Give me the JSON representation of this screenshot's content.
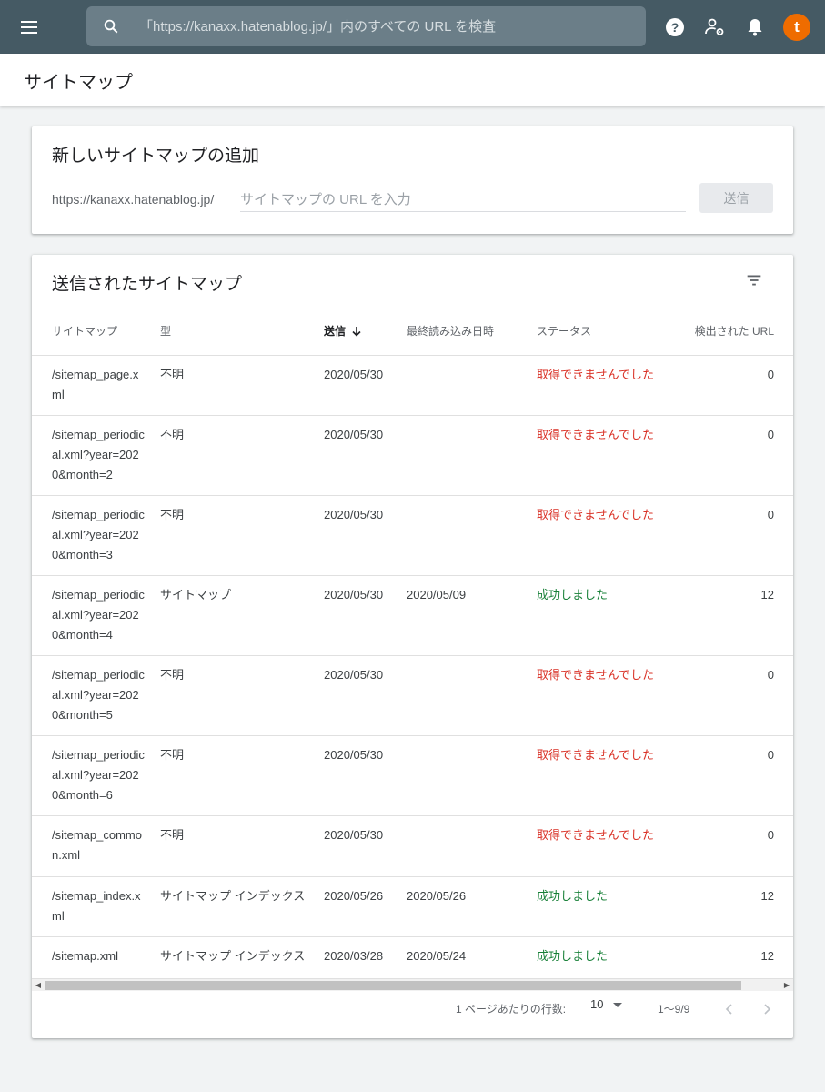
{
  "header": {
    "search_placeholder": "「https://kanaxx.hatenablog.jp/」内のすべての URL を検査",
    "avatar_letter": "t",
    "avatar_color": "#ef6c00"
  },
  "page": {
    "title": "サイトマップ"
  },
  "add_card": {
    "title": "新しいサイトマップの追加",
    "prefix": "https://kanaxx.hatenablog.jp/",
    "input_placeholder": "サイトマップの URL を入力",
    "submit_label": "送信"
  },
  "list_card": {
    "title": "送信されたサイトマップ",
    "columns": [
      "サイトマップ",
      "型",
      "送信",
      "最終読み込み日時",
      "ステータス",
      "検出された URL"
    ],
    "sort_column": "送信",
    "sort_direction": "desc",
    "rows": [
      {
        "path": "/sitemap_page.xml",
        "type": "不明",
        "submitted": "2020/05/30",
        "last_read": "",
        "status": "取得できませんでした",
        "status_ok": false,
        "count": "0"
      },
      {
        "path": "/sitemap_periodical.xml?year=2020&month=2",
        "type": "不明",
        "submitted": "2020/05/30",
        "last_read": "",
        "status": "取得できませんでした",
        "status_ok": false,
        "count": "0"
      },
      {
        "path": "/sitemap_periodical.xml?year=2020&month=3",
        "type": "不明",
        "submitted": "2020/05/30",
        "last_read": "",
        "status": "取得できませんでした",
        "status_ok": false,
        "count": "0"
      },
      {
        "path": "/sitemap_periodical.xml?year=2020&month=4",
        "type": "サイトマップ",
        "submitted": "2020/05/30",
        "last_read": "2020/05/09",
        "status": "成功しました",
        "status_ok": true,
        "count": "12"
      },
      {
        "path": "/sitemap_periodical.xml?year=2020&month=5",
        "type": "不明",
        "submitted": "2020/05/30",
        "last_read": "",
        "status": "取得できませんでした",
        "status_ok": false,
        "count": "0"
      },
      {
        "path": "/sitemap_periodical.xml?year=2020&month=6",
        "type": "不明",
        "submitted": "2020/05/30",
        "last_read": "",
        "status": "取得できませんでした",
        "status_ok": false,
        "count": "0"
      },
      {
        "path": "/sitemap_common.xml",
        "type": "不明",
        "submitted": "2020/05/30",
        "last_read": "",
        "status": "取得できませんでした",
        "status_ok": false,
        "count": "0"
      },
      {
        "path": "/sitemap_index.xml",
        "type": "サイトマップ インデックス",
        "submitted": "2020/05/26",
        "last_read": "2020/05/26",
        "status": "成功しました",
        "status_ok": true,
        "count": "12"
      },
      {
        "path": "/sitemap.xml",
        "type": "サイトマップ インデックス",
        "submitted": "2020/03/28",
        "last_read": "2020/05/24",
        "status": "成功しました",
        "status_ok": true,
        "count": "12"
      }
    ],
    "pagination": {
      "rows_per_page_label": "1 ページあたりの行数:",
      "rows_per_page": "10",
      "range": "1〜9/9"
    }
  },
  "colors": {
    "topbar": "#455a64",
    "fail": "#d93025",
    "success": "#188038"
  }
}
